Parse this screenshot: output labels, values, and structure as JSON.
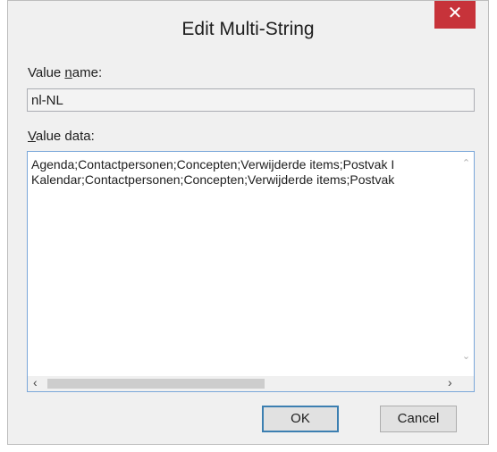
{
  "dialog": {
    "title": "Edit Multi-String",
    "close_glyph": "✕"
  },
  "value_name": {
    "label_underlined": "n",
    "label_prefix": "Value ",
    "label_suffix": "ame:",
    "value": "nl-NL"
  },
  "value_data": {
    "label_underlined": "V",
    "label_suffix": "alue data:",
    "lines": [
      "Agenda;Contactpersonen;Concepten;Verwijderde items;Postvak I",
      "Kalendar;Contactpersonen;Concepten;Verwijderde items;Postvak"
    ]
  },
  "scroll": {
    "up": "⌃",
    "down": "⌄",
    "left": "‹",
    "right": "›"
  },
  "buttons": {
    "ok": "OK",
    "cancel": "Cancel"
  },
  "colors": {
    "close_button": "#c7333a",
    "focus_border": "#7aa7d9",
    "default_button_border": "#3c7fb1"
  }
}
